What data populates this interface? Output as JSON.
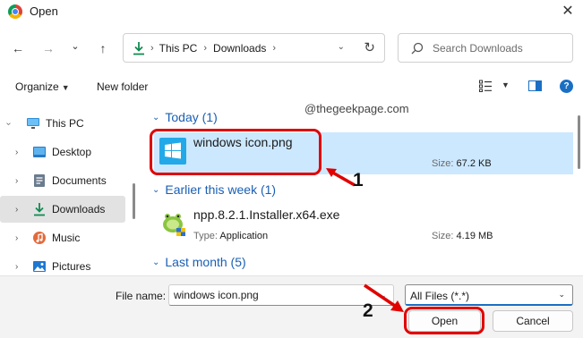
{
  "window": {
    "title": "Open",
    "close_glyph": "✕"
  },
  "nav": {
    "back": "←",
    "forward": "→",
    "recent": "⌄",
    "up": "↑"
  },
  "address": {
    "crumbs": [
      "This PC",
      "Downloads"
    ],
    "sep": "›",
    "dropdown": "⌄",
    "refresh": "↻"
  },
  "search": {
    "placeholder": "Search Downloads"
  },
  "commandbar": {
    "organize": "Organize",
    "organize_caret": "▼",
    "new_folder": "New folder",
    "view_caret": "▼",
    "help": "?"
  },
  "navpane": {
    "chev": "›",
    "items": [
      {
        "label": "This PC",
        "icon": "monitor-icon"
      },
      {
        "label": "Desktop",
        "icon": "desktop-folder-icon"
      },
      {
        "label": "Documents",
        "icon": "documents-icon"
      },
      {
        "label": "Downloads",
        "icon": "download-icon",
        "selected": true
      },
      {
        "label": "Music",
        "icon": "music-icon"
      },
      {
        "label": "Pictures",
        "icon": "pictures-icon"
      }
    ]
  },
  "watermark": "@thegeekpage.com",
  "groups": [
    {
      "label": "Today (1)",
      "chev": "⌄"
    },
    {
      "label": "Earlier this week (1)",
      "chev": "⌄"
    },
    {
      "label": "Last month (5)",
      "chev": "⌄"
    }
  ],
  "files": [
    {
      "name": "windows icon.png",
      "type_label": "",
      "type_value": "",
      "size_label": "Size:",
      "size_value": "67.2 KB",
      "icon": "windows-image-icon",
      "selected": true
    },
    {
      "name": "npp.8.2.1.Installer.x64.exe",
      "type_label": "Type:",
      "type_value": "Application",
      "size_label": "Size:",
      "size_value": "4.19 MB",
      "icon": "notepad-plus-plus-icon",
      "selected": false
    }
  ],
  "footer": {
    "filename_label": "File name:",
    "filename_value": "windows icon.png",
    "filename_drop": "⌄",
    "filetype_value": "All Files (*.*)",
    "filetype_caret": "⌄",
    "open": "Open",
    "cancel": "Cancel"
  },
  "annotations": {
    "step1": "1",
    "step2": "2"
  },
  "colors": {
    "accent": "#1a6fc4",
    "selection": "#cce8ff",
    "annotation": "#e00000",
    "group_header": "#1a5fb4"
  }
}
